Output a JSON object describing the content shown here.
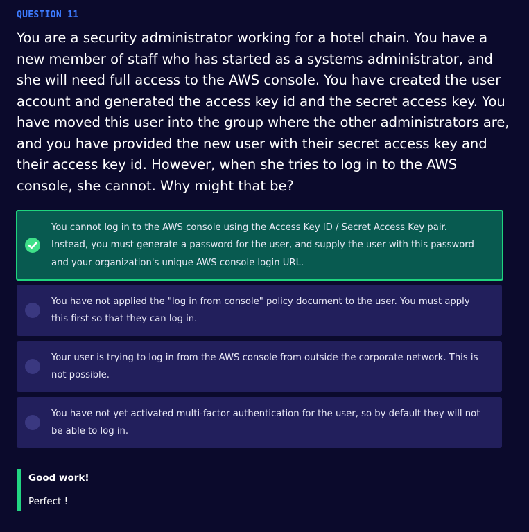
{
  "question": {
    "label": "QUESTION 11",
    "text": "You are a security administrator working for a hotel chain. You have a new member of staff who has started as a systems administrator, and she will need full access to the AWS console. You have created the user account and generated the access key id and the secret access key. You have moved this user into the group where the other administrators are, and you have provided the new user with their secret access key and their access key id. However, when she tries to log in to the AWS console, she cannot. Why might that be?"
  },
  "options": [
    {
      "text": "You cannot log in to the AWS console using the Access Key ID / Secret Access Key pair. Instead, you must generate a password for the user, and supply the user with this password and your organization's unique AWS console login URL.",
      "state": "correct",
      "icon": "check-circle-icon"
    },
    {
      "text": "You have not applied the \"log in from console\" policy document to the user. You must apply this first so that they can log in.",
      "state": "unselected",
      "icon": "radio-circle-icon"
    },
    {
      "text": "Your user is trying to log in from the AWS console from outside the corporate network. This is not possible.",
      "state": "unselected",
      "icon": "radio-circle-icon"
    },
    {
      "text": "You have not yet activated multi-factor authentication for the user, so by default they will not be able to log in.",
      "state": "unselected",
      "icon": "radio-circle-icon"
    }
  ],
  "feedback": {
    "title": "Good work!",
    "message": "Perfect !"
  },
  "colors": {
    "background": "#0b0a2c",
    "question_label": "#3d7bff",
    "option_bg": "#221f5c",
    "correct_bg": "#085a50",
    "correct_border": "#1fd47e",
    "feedback_accent": "#22d483"
  }
}
